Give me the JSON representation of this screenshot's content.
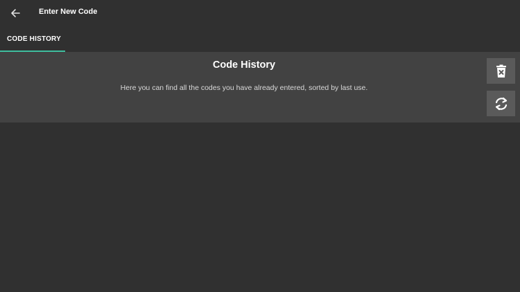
{
  "appbar": {
    "title": "Enter New Code",
    "back_icon": "arrow-left-icon"
  },
  "tabs": [
    {
      "label": "CODE HISTORY",
      "active": true
    }
  ],
  "panel": {
    "title": "Code History",
    "description": "Here you can find all the codes you have already entered, sorted by last use."
  },
  "actions": {
    "delete_icon": "trash-icon",
    "refresh_icon": "refresh-icon"
  },
  "colors": {
    "background": "#303030",
    "panel": "#424242",
    "button": "#5a5a5a",
    "accent": "#3fbf9f"
  }
}
